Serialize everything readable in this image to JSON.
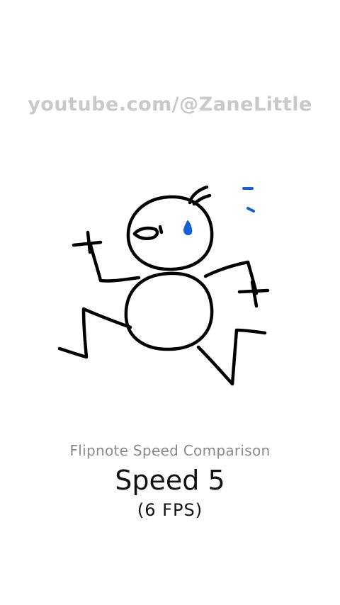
{
  "watermark": {
    "text": "youtube.com/@ZaneLittle"
  },
  "drawing": {
    "subject": "stick-figure-running-sweating",
    "ink_color": "#000000",
    "sweat_color": "#1560d8"
  },
  "caption": {
    "title": "Flipnote Speed Comparison",
    "speed": "Speed 5",
    "fps": "(6 FPS)"
  }
}
